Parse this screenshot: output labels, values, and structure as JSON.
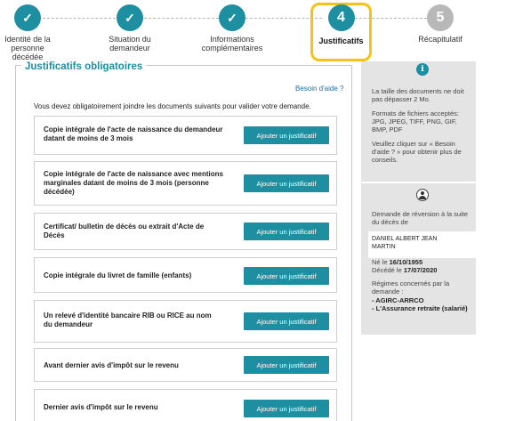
{
  "stepper": {
    "steps": [
      {
        "number": "✓",
        "label": "Identité de la personne décédée",
        "state": "done"
      },
      {
        "number": "✓",
        "label": "Situation du demandeur",
        "state": "done"
      },
      {
        "number": "✓",
        "label": "Informations complémentaires",
        "state": "done"
      },
      {
        "number": "4",
        "label": "Justificatifs",
        "state": "current"
      },
      {
        "number": "5",
        "label": "Récapitulatif",
        "state": "todo"
      }
    ]
  },
  "main": {
    "title": "Justificatifs obligatoires",
    "help_link": "Besoin d'aide ?",
    "intro": "Vous devez obligatoirement joindre les documents suivants pour valider votre demande.",
    "button_label": "Ajouter un justificatif",
    "documents": [
      "Copie intégrale de l'acte de naissance du demandeur datant de moins de 3 mois",
      "Copie intégrale de l'acte de naissance avec mentions marginales datant de moins de 3 mois (personne décédée)",
      "Certificat/ bulletin de décès ou extrait d'Acte de Décès",
      "Copie intégrale du livret de famille (enfants)",
      "Un relevé d'identité bancaire RIB ou RICE au nom du demandeur",
      "Avant dernier avis d'impôt sur le revenu",
      "Dernier avis d'impôt sur le revenu"
    ]
  },
  "info_panel": {
    "icon": "info-icon",
    "size_note": "La taille des documents ne doit pas dépasser 2 Mo.",
    "formats": "Formats de fichiers acceptés: JPG, JPEG, TIFF, PNG, GIF, BMP, PDF",
    "help_note": "Veuillez cliquer sur « Besoin d'aide ? » pour obtenir plus de conseils."
  },
  "person_panel": {
    "icon": "user-icon",
    "request": "Demande de réversion à la suite du décès de",
    "name_line1": "DANIEL ALBERT JEAN",
    "name_line2": "MARTIN",
    "born_label": "Né le",
    "born_date": "16/10/1955",
    "died_label": "Décédé le",
    "died_date": "17/07/2020",
    "regimes_label": "Régimes concernés par la demande :",
    "regime1": "- AGIRC-ARRCO",
    "regime2": "- L'Assurance retraite (salarié)"
  },
  "colors": {
    "accent": "#1d8fa0",
    "highlight": "#f5c216",
    "pending": "#b8b8b8"
  }
}
